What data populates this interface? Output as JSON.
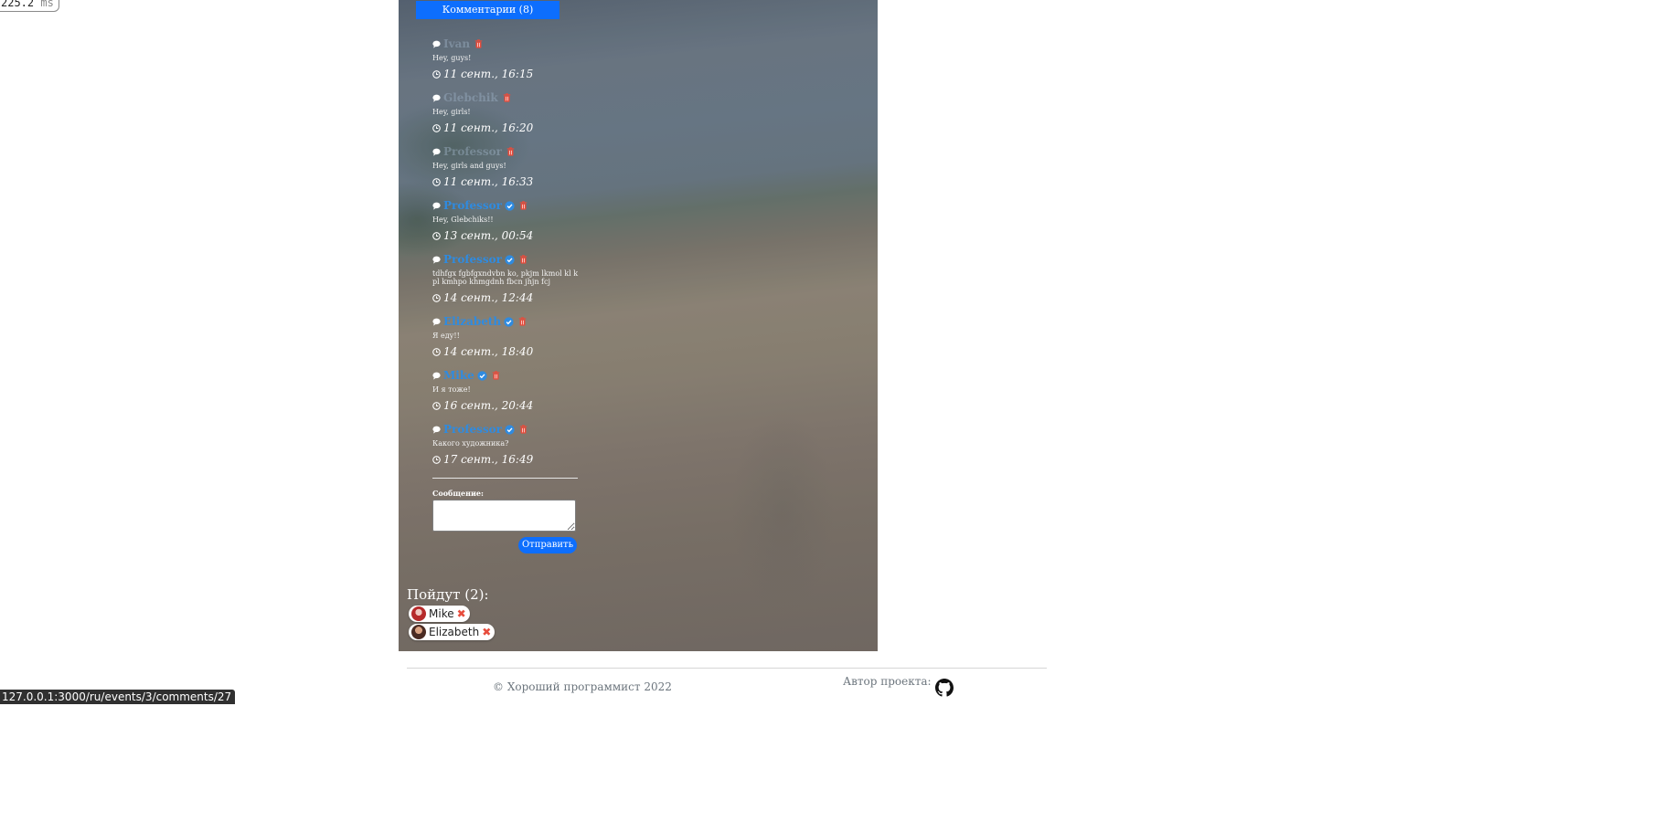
{
  "perf": {
    "value": "225.2",
    "unit": "ms"
  },
  "comments_header": "Комментарии (8)",
  "comments": [
    {
      "author": "Ivan",
      "text": "Hey, guys!",
      "time": "11 сент., 16:15",
      "verified": false,
      "faded": true
    },
    {
      "author": "Glebchik",
      "text": "Hey, girls!",
      "time": "11 сент., 16:20",
      "verified": false,
      "faded": true
    },
    {
      "author": "Professor",
      "text": "Hey, girls and guys!",
      "time": "11 сент., 16:33",
      "verified": false,
      "faded": true
    },
    {
      "author": "Professor",
      "text": "Hey, Glebchiks!!",
      "time": "13 сент., 00:54",
      "verified": true,
      "faded": false
    },
    {
      "author": "Professor",
      "text": "tdhfgx fgbfgxndvbn ko, pkjm lkmol kl k pl kmhpo khmgdnh fbcn jhjn fcj",
      "time": "14 сент., 12:44",
      "verified": true,
      "faded": false
    },
    {
      "author": "Elizabeth",
      "text": "Я еду!!",
      "time": "14 сент., 18:40",
      "verified": true,
      "faded": false
    },
    {
      "author": "Mike",
      "text": "И я тоже!",
      "time": "16 сент., 20:44",
      "verified": true,
      "faded": false
    },
    {
      "author": "Professor",
      "text": "Какого художника?",
      "time": "17 сент., 16:49",
      "verified": true,
      "faded": false
    }
  ],
  "form": {
    "label": "Сообщение:",
    "value": "",
    "submit": "Отправить"
  },
  "going": {
    "title": "Пойдут (2):",
    "people": [
      {
        "name": "Mike"
      },
      {
        "name": "Elizabeth"
      }
    ]
  },
  "footer": {
    "copyright": "© Хороший программист 2022",
    "author_label": "Автор проекта:"
  },
  "status_url": "127.0.0.1:3000/ru/events/3/comments/27",
  "colors": {
    "accent": "#0d6efd",
    "verified": "#2f8be0",
    "danger": "#e74c3c"
  },
  "icons": {
    "comment": "speech-bubble-icon",
    "verified": "check-badge-icon",
    "delete": "trash-icon",
    "time": "clock-icon",
    "remove": "cross-icon",
    "repo": "github-icon"
  }
}
